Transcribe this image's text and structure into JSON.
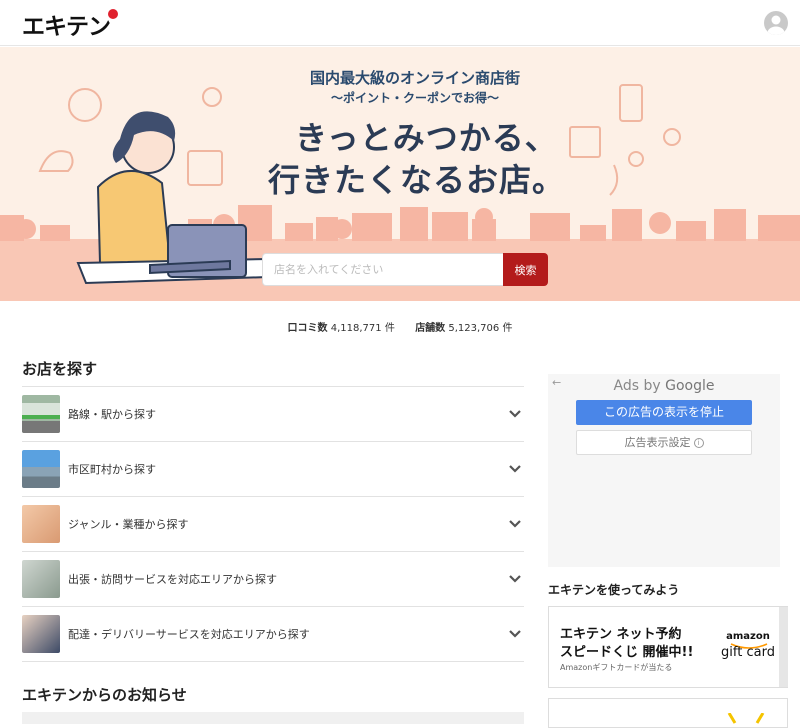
{
  "header": {
    "logo_text": "エキテン",
    "avatar_icon": "user-avatar-icon"
  },
  "hero": {
    "tagline": "国内最大級のオンライン商店街",
    "subtagline": "～ポイント・クーポンでお得～",
    "title_line1": "きっとみつかる、",
    "title_line2": "行きたくなるお店。",
    "search_placeholder": "店名を入れてください",
    "search_button": "検索"
  },
  "stats": {
    "reviews_label": "口コミ数",
    "reviews_value": "4,118,771",
    "reviews_unit": "件",
    "shops_label": "店舗数",
    "shops_value": "5,123,706",
    "shops_unit": "件"
  },
  "find": {
    "title": "お店を探す",
    "items": [
      {
        "label": "路線・駅から探す"
      },
      {
        "label": "市区町村から探す"
      },
      {
        "label": "ジャンル・業種から探す"
      },
      {
        "label": "出張・訪問サービスを対応エリアから探す"
      },
      {
        "label": "配達・デリバリーサービスを対応エリアから探す"
      }
    ]
  },
  "news": {
    "title": "エキテンからのお知らせ"
  },
  "ad": {
    "back": "←",
    "ads_by": "Ads by",
    "google": "Google",
    "stop_label": "この広告の表示を停止",
    "settings_label": "広告表示設定",
    "info_glyph": "i"
  },
  "try": {
    "title": "エキテンを使ってみよう",
    "banner_line1": "エキテン ネット予約",
    "banner_line2": "スピードくじ 開催中!!",
    "banner_line3": "Amazonギフトカードが当たる",
    "amazon_logo": "amazon",
    "gift_card": "gift card"
  },
  "colors": {
    "accent_red": "#b31b1b",
    "logo_dot": "#e0212e",
    "hero_bg": "#fdf0e6",
    "hero_band": "#f9c7b5",
    "ad_blue": "#4a86e8"
  }
}
